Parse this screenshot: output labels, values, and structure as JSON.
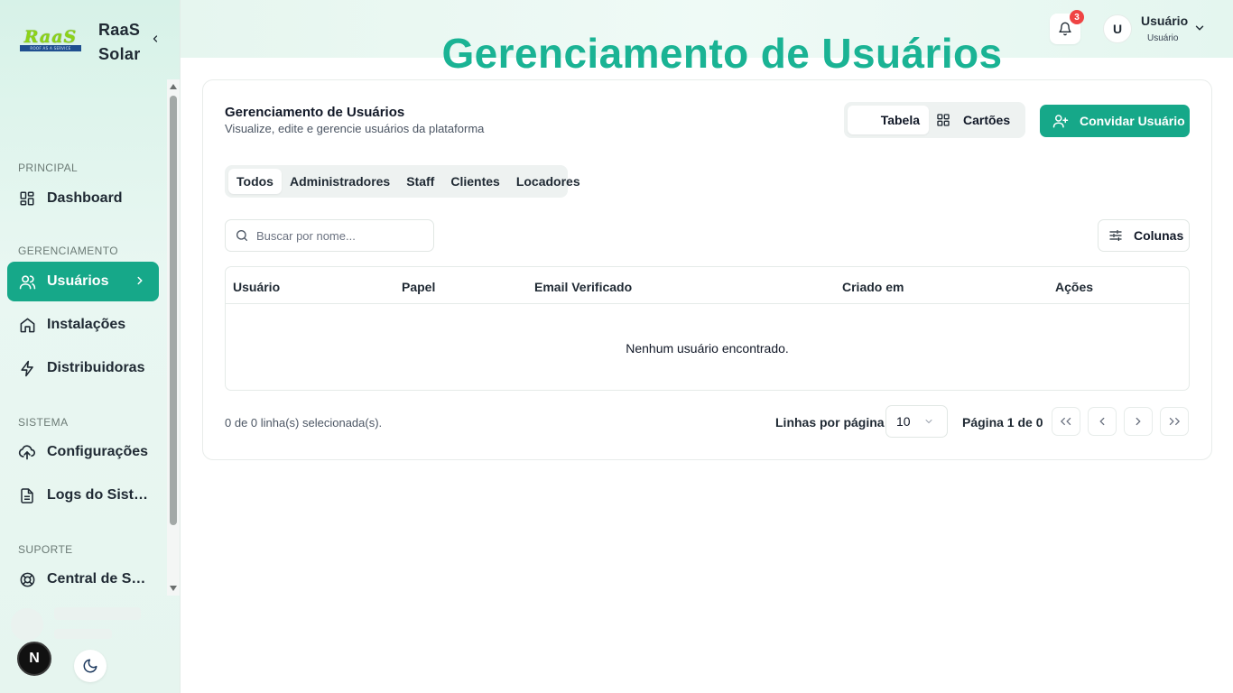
{
  "brand": {
    "logo_text": "RaaS",
    "logo_tagline": "ROOF AS A SERVICE",
    "name_line1": "RaaS",
    "name_line2": "Solar"
  },
  "sidebar": {
    "sections": [
      {
        "label": "PRINCIPAL"
      },
      {
        "label": "GERENCIAMENTO"
      },
      {
        "label": "SISTEMA"
      },
      {
        "label": "SUPORTE"
      }
    ],
    "items": [
      {
        "label": "Dashboard",
        "icon": "dashboard-icon",
        "active": false
      },
      {
        "label": "Usuários",
        "icon": "users-icon",
        "active": true
      },
      {
        "label": "Instalações",
        "icon": "home-icon",
        "active": false
      },
      {
        "label": "Distribuidoras",
        "icon": "zap-icon",
        "active": false
      },
      {
        "label": "Configurações",
        "icon": "cloud-upload-icon",
        "active": false
      },
      {
        "label": "Logs do Sistema",
        "icon": "file-text-icon",
        "active": false
      },
      {
        "label": "Central de Suporte",
        "icon": "lifebuoy-icon",
        "active": false
      }
    ],
    "badge_letter": "N"
  },
  "header": {
    "page_heading": "Gerenciamento de Usuários",
    "notification_count": "3",
    "user_initial": "U",
    "user_name": "Usuário",
    "user_role": "Usuário"
  },
  "main": {
    "title": "Gerenciamento de Usuários",
    "subtitle": "Visualize, edite e gerencie usuários da plataforma",
    "view_toggle": {
      "table_label": "Tabela",
      "cards_label": "Cartões"
    },
    "invite_label": "Convidar Usuário",
    "filter_tabs": [
      {
        "label": "Todos",
        "active": true
      },
      {
        "label": "Administradores",
        "active": false
      },
      {
        "label": "Staff",
        "active": false
      },
      {
        "label": "Clientes",
        "active": false
      },
      {
        "label": "Locadores",
        "active": false
      }
    ],
    "search": {
      "placeholder": "Buscar por nome...",
      "value": ""
    },
    "columns_label": "Colunas",
    "table": {
      "headers": [
        "Usuário",
        "Papel",
        "Email Verificado",
        "Criado em",
        "Ações"
      ],
      "empty_message": "Nenhum usuário encontrado."
    },
    "footer": {
      "selection": "0 de 0 linha(s) selecionada(s).",
      "rows_per_page_label": "Linhas por página",
      "rows_per_page_value": "10",
      "page_info": "Página 1 de 0"
    }
  },
  "colors": {
    "accent": "#16a889",
    "heading_teal": "#1ab394",
    "badge_red": "#ef4444"
  }
}
